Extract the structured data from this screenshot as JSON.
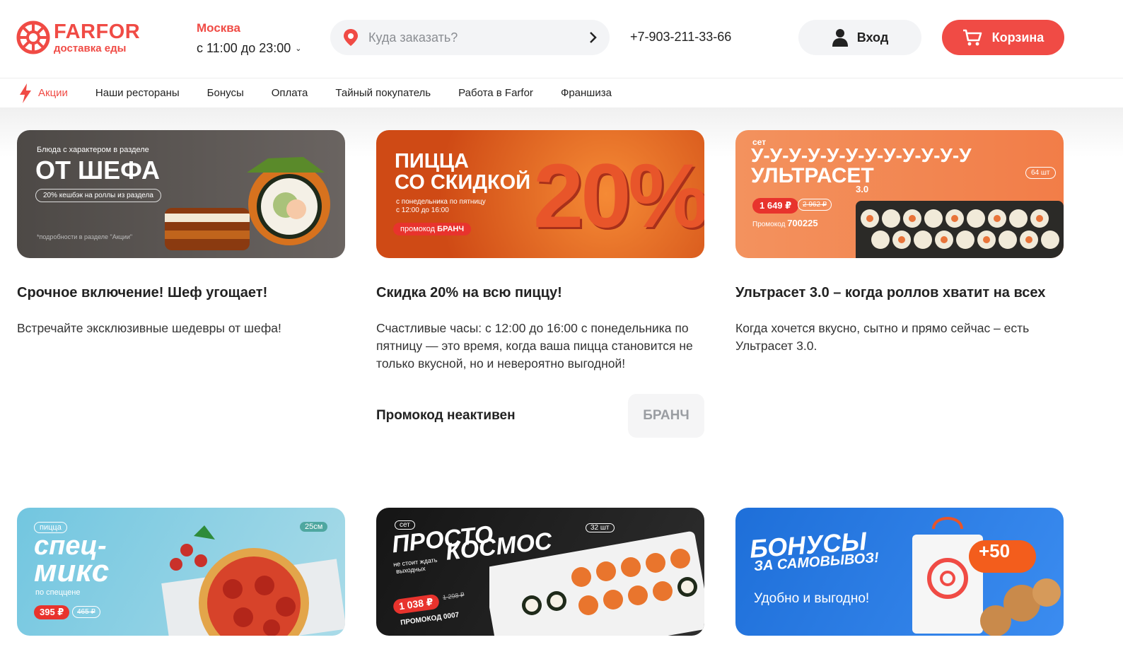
{
  "brand": {
    "name": "FARFOR",
    "tagline": "доставка еды",
    "accent": "#f04b45"
  },
  "location": {
    "city": "Москва",
    "hours": "с 11:00 до 23:00"
  },
  "search": {
    "placeholder": "Куда заказать?"
  },
  "phone": "+7-903-211-33-66",
  "header_buttons": {
    "login": "Вход",
    "cart": "Корзина"
  },
  "nav": {
    "items": [
      "Акции",
      "Наши рестораны",
      "Бонусы",
      "Оплата",
      "Тайный покупатель",
      "Работа в Farfor",
      "Франшиза"
    ],
    "active": "Акции"
  },
  "promos": [
    {
      "title": "Срочное включение! Шеф угощает!",
      "text": "Встречайте эксклюзивные шедевры от шефа!",
      "banner": {
        "top": "Блюда с характером в разделе",
        "headline": "ОТ ШЕФА",
        "pill": "20% кешбэк на роллы из раздела",
        "note": "*подробности в разделе \"Акции\""
      }
    },
    {
      "title": "Скидка 20% на всю пиццу!",
      "text": "Счастливые часы: с 12:00 до 16:00 с понедельника по пятницу — это время, когда ваша пицца становится не только вкусной, но и невероятно выгодной!",
      "promo_status": "Промокод неактивен",
      "promo_code": "БРАНЧ",
      "banner": {
        "headline1": "ПИЦЦА",
        "headline2": "СО СКИДКОЙ",
        "sub1": "с понедельника по пятницу",
        "sub2": "с 12:00 до 16:00",
        "pill_label": "промокод",
        "pill_code": "БРАНЧ",
        "big": "20%"
      }
    },
    {
      "title": "Ультрасет 3.0 – когда роллов хватит на всех",
      "text": "Когда хочется вкусно, сытно и прямо сейчас – есть Ультрасет 3.0.",
      "banner": {
        "label": "сет",
        "headline1": "У-У-У-У-У-У-У-У-У-У-У-У",
        "headline2": "УЛЬТРАСЕТ",
        "version": "3.0",
        "count": "64 шт",
        "price": "1 649 ₽",
        "old_price": "2 962 ₽",
        "promo_label": "Промокод",
        "promo_code": "700225"
      }
    },
    {
      "banner": {
        "label": "пицца",
        "size": "25см",
        "headline1": "спец-",
        "headline2": "микс",
        "sub": "по спеццене",
        "price": "395 ₽",
        "old_price": "465 ₽"
      }
    },
    {
      "banner": {
        "label": "сет",
        "headline1": "ПРОСТО",
        "headline2": "КОСМОС",
        "count": "32 шт",
        "sub1": "не стоит ждать",
        "sub2": "выходных",
        "price": "1 038 ₽",
        "old_price": "1 298 ₽",
        "promo": "ПРОМОКОД 0007"
      }
    },
    {
      "banner": {
        "headline1": "БОНУСЫ",
        "headline2": "ЗА САМОВЫВОЗ!",
        "sub": "Удобно и выгодно!",
        "badge": "+50"
      }
    }
  ]
}
